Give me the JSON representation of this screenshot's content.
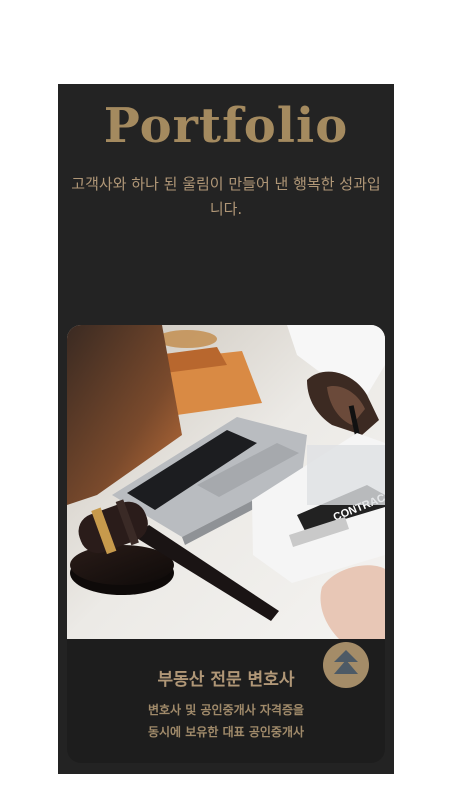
{
  "portfolio": {
    "title": "Portfolio",
    "subtitle": "고객사와 하나 된 울림이 만들어 낸 행복한 성과입니다."
  },
  "card": {
    "image_icon": "lawyer-desk-photo",
    "title": "부동산 전문 변호사",
    "desc_line1": "변호사 및 공인중개사 자격증을",
    "desc_line2": "동시에 보유한 대표 공인중개사"
  },
  "scroll_top_icon": "double-chevron-up-icon",
  "colors": {
    "section_bg": "#232323",
    "accent_gold": "#a48a5f",
    "text_gold": "#b09777",
    "icon_slate": "#4d5a66"
  }
}
